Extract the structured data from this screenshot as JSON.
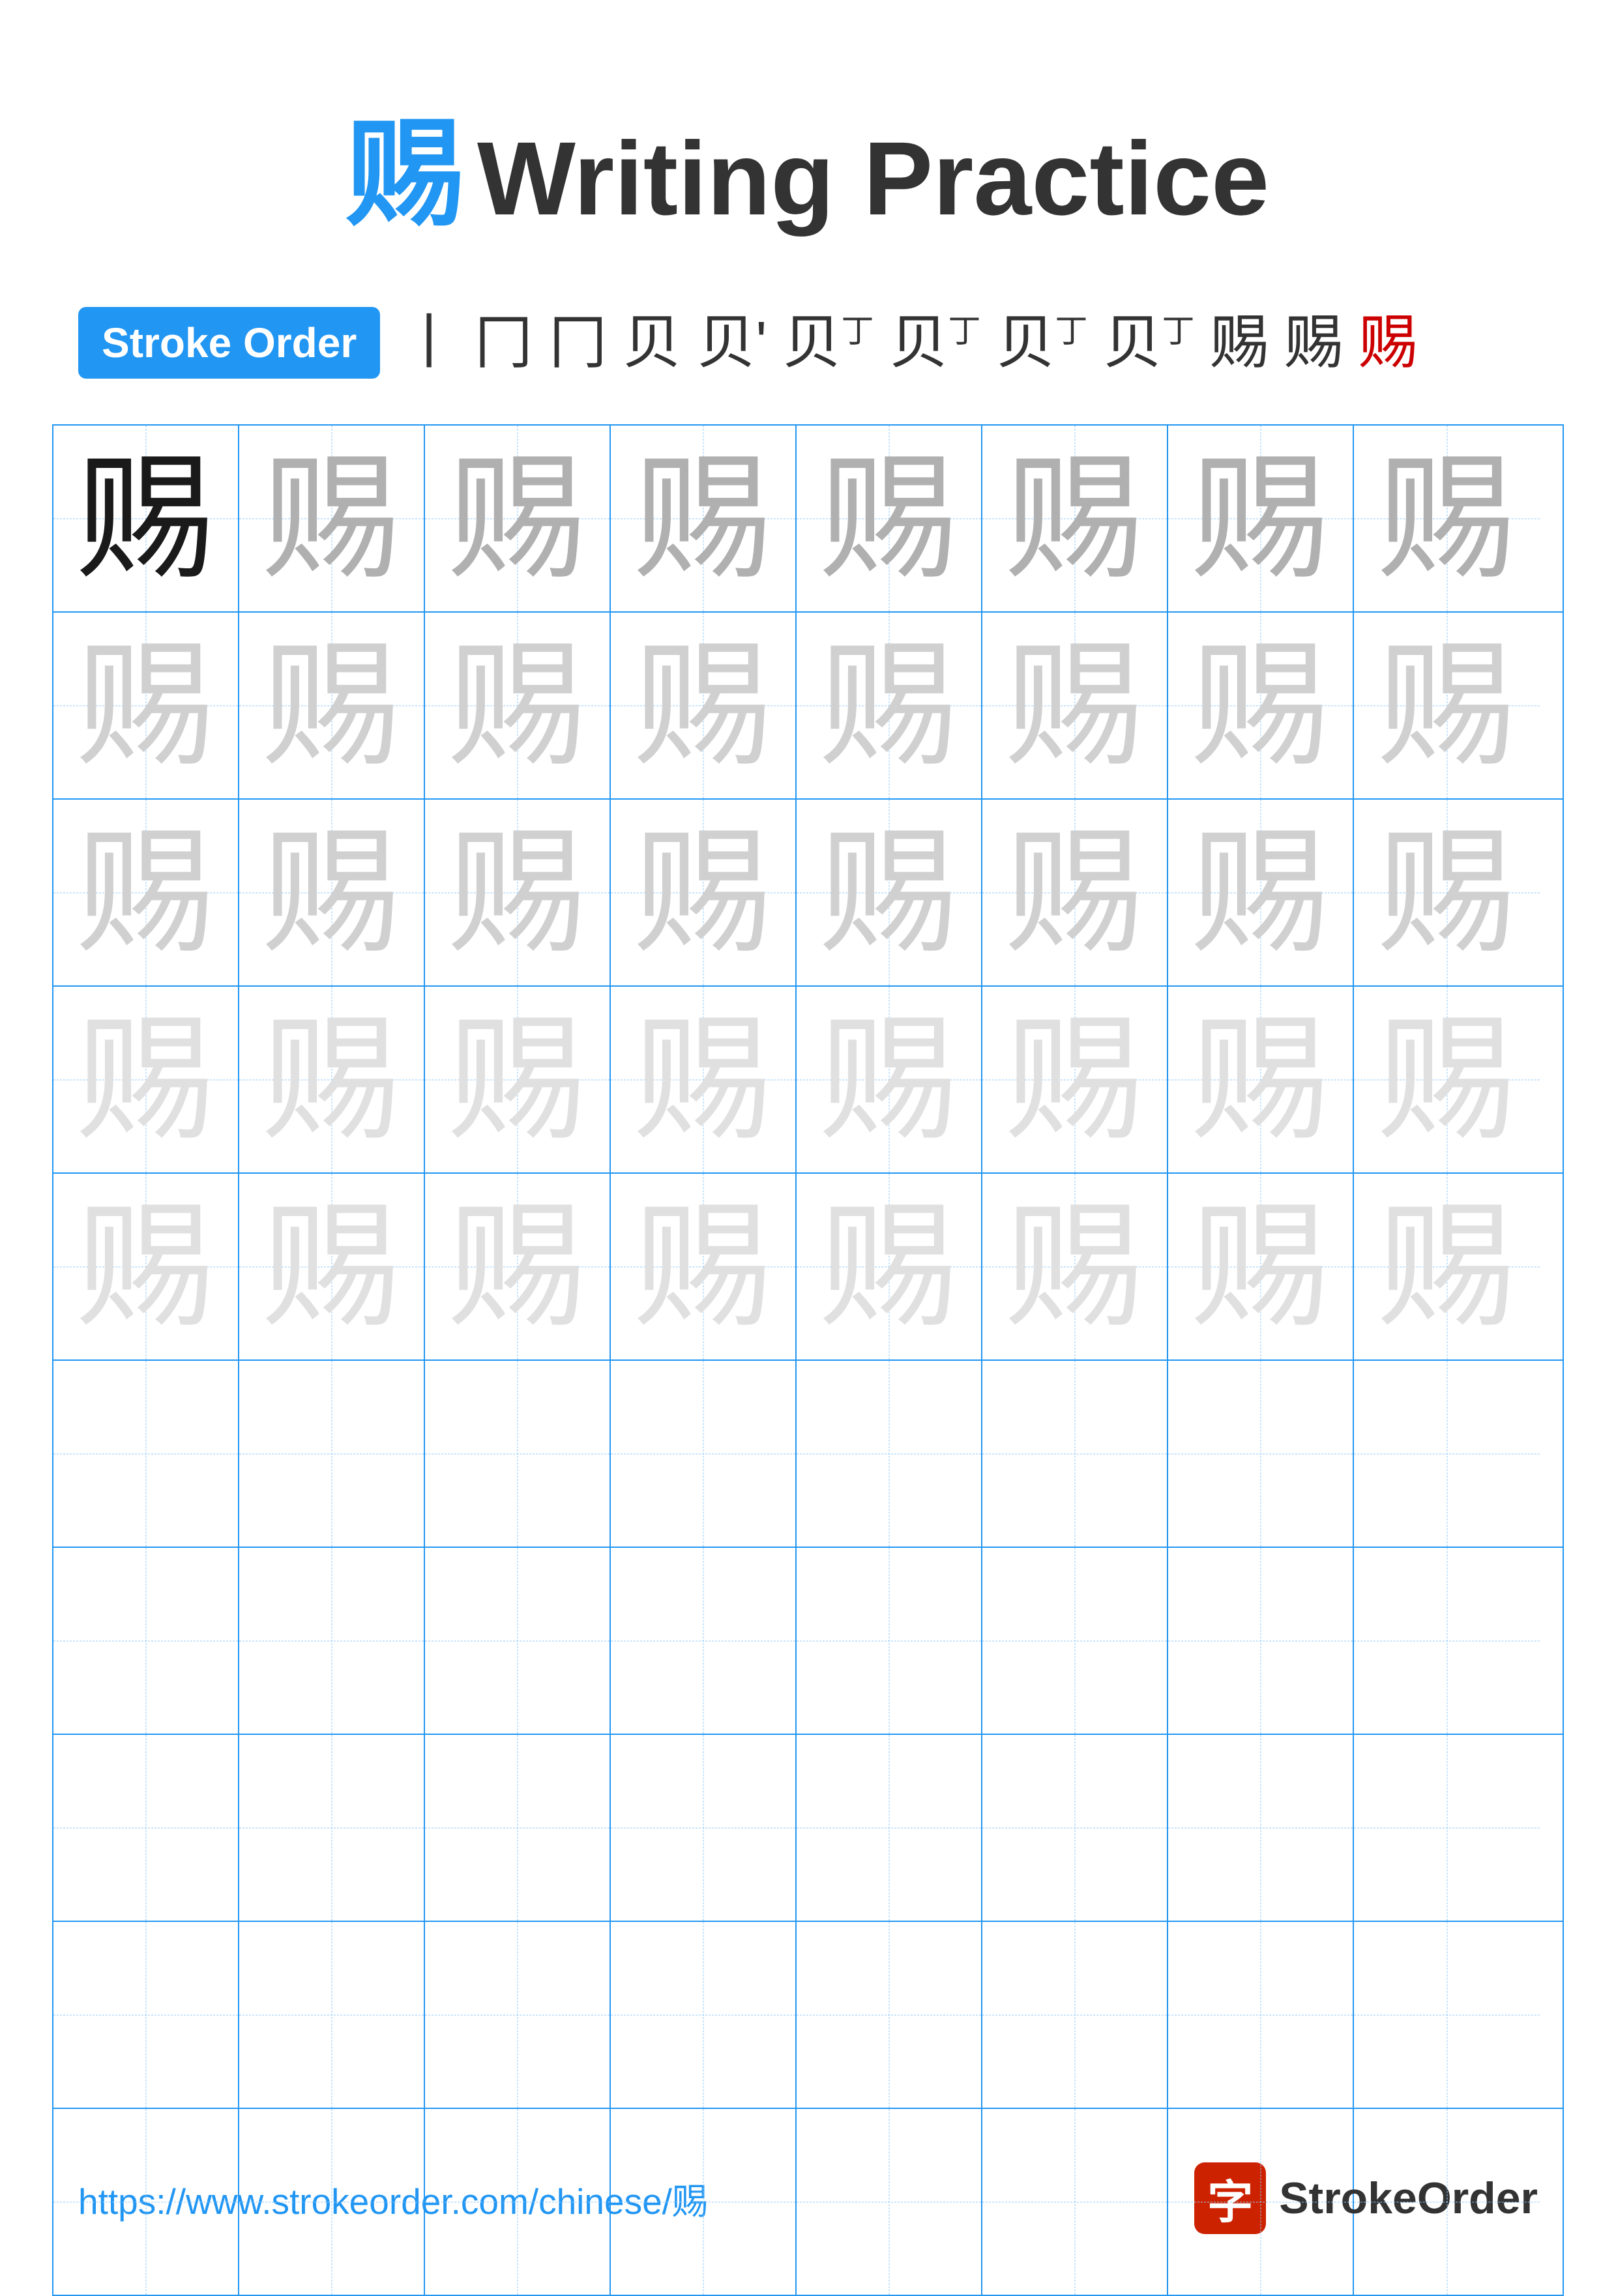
{
  "title": {
    "char": "赐",
    "text": "Writing Practice"
  },
  "stroke_order": {
    "badge_label": "Stroke Order",
    "steps": [
      "丨",
      "冂",
      "冂",
      "贝",
      "贝'",
      "贝丁",
      "贝丁",
      "贝丁",
      "贝丁",
      "赐",
      "赐",
      "赐"
    ]
  },
  "grid": {
    "char": "赐",
    "rows": 10,
    "cols": 8,
    "shading": [
      [
        "dark",
        "medium",
        "medium",
        "medium",
        "medium",
        "medium",
        "medium",
        "medium"
      ],
      [
        "light",
        "light",
        "light",
        "light",
        "light",
        "light",
        "light",
        "light"
      ],
      [
        "light",
        "light",
        "light",
        "light",
        "light",
        "light",
        "light",
        "light"
      ],
      [
        "faint",
        "faint",
        "faint",
        "faint",
        "faint",
        "faint",
        "faint",
        "faint"
      ],
      [
        "faint",
        "faint",
        "faint",
        "faint",
        "faint",
        "faint",
        "faint",
        "faint"
      ],
      [
        "empty",
        "empty",
        "empty",
        "empty",
        "empty",
        "empty",
        "empty",
        "empty"
      ],
      [
        "empty",
        "empty",
        "empty",
        "empty",
        "empty",
        "empty",
        "empty",
        "empty"
      ],
      [
        "empty",
        "empty",
        "empty",
        "empty",
        "empty",
        "empty",
        "empty",
        "empty"
      ],
      [
        "empty",
        "empty",
        "empty",
        "empty",
        "empty",
        "empty",
        "empty",
        "empty"
      ],
      [
        "empty",
        "empty",
        "empty",
        "empty",
        "empty",
        "empty",
        "empty",
        "empty"
      ]
    ]
  },
  "footer": {
    "url": "https://www.strokeorder.com/chinese/赐",
    "logo_char": "字",
    "logo_name": "StrokeOrder"
  }
}
